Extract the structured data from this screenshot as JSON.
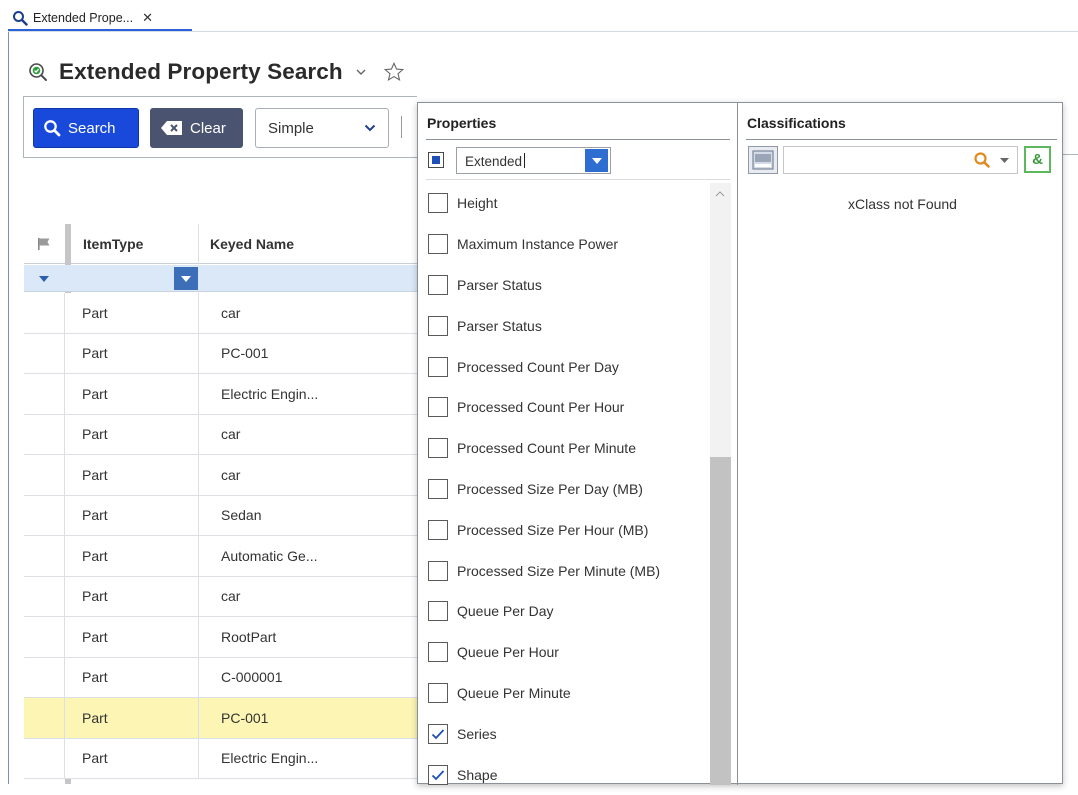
{
  "tab": {
    "label": "Extended Prope...",
    "close": "✕"
  },
  "header": {
    "title": "Extended Property Search"
  },
  "toolbar": {
    "search_label": "Search",
    "clear_label": "Clear",
    "mode_value": "Simple"
  },
  "grid": {
    "columns": [
      "ItemType",
      "Keyed Name"
    ],
    "rows": [
      {
        "itemtype": "Part",
        "keyed_name": "car"
      },
      {
        "itemtype": "Part",
        "keyed_name": "PC-001"
      },
      {
        "itemtype": "Part",
        "keyed_name": "Electric Engin..."
      },
      {
        "itemtype": "Part",
        "keyed_name": "car"
      },
      {
        "itemtype": "Part",
        "keyed_name": "car"
      },
      {
        "itemtype": "Part",
        "keyed_name": "Sedan"
      },
      {
        "itemtype": "Part",
        "keyed_name": "Automatic Ge..."
      },
      {
        "itemtype": "Part",
        "keyed_name": "car"
      },
      {
        "itemtype": "Part",
        "keyed_name": "RootPart"
      },
      {
        "itemtype": "Part",
        "keyed_name": "C-000001"
      },
      {
        "itemtype": "Part",
        "keyed_name": "PC-001",
        "selected": true
      },
      {
        "itemtype": "Part",
        "keyed_name": "Electric Engin..."
      }
    ]
  },
  "properties": {
    "title": "Properties",
    "filter_value": "Extended",
    "items": [
      {
        "label": "Height",
        "checked": false
      },
      {
        "label": "Maximum Instance Power",
        "checked": false
      },
      {
        "label": "Parser Status",
        "checked": false
      },
      {
        "label": "Parser Status",
        "checked": false
      },
      {
        "label": "Processed Count Per Day",
        "checked": false
      },
      {
        "label": "Processed Count Per Hour",
        "checked": false
      },
      {
        "label": "Processed Count Per Minute",
        "checked": false
      },
      {
        "label": "Processed Size Per Day (MB)",
        "checked": false
      },
      {
        "label": "Processed Size Per Hour (MB)",
        "checked": false
      },
      {
        "label": "Processed Size Per Minute (MB)",
        "checked": false
      },
      {
        "label": "Queue Per Day",
        "checked": false
      },
      {
        "label": "Queue Per Hour",
        "checked": false
      },
      {
        "label": "Queue Per Minute",
        "checked": false
      },
      {
        "label": "Series",
        "checked": true
      },
      {
        "label": "Shape",
        "checked": true
      }
    ]
  },
  "classifications": {
    "title": "Classifications",
    "search_value": "",
    "amp_label": "&",
    "empty_message": "xClass not Found"
  },
  "colors": {
    "primary_blue": "#1849db",
    "clear_button": "#4a5470",
    "selected_row": "#fdf5b4",
    "filter_row": "#dbe8f8",
    "accent_green": "#5cb85c",
    "search_orange": "#e08a1e"
  }
}
